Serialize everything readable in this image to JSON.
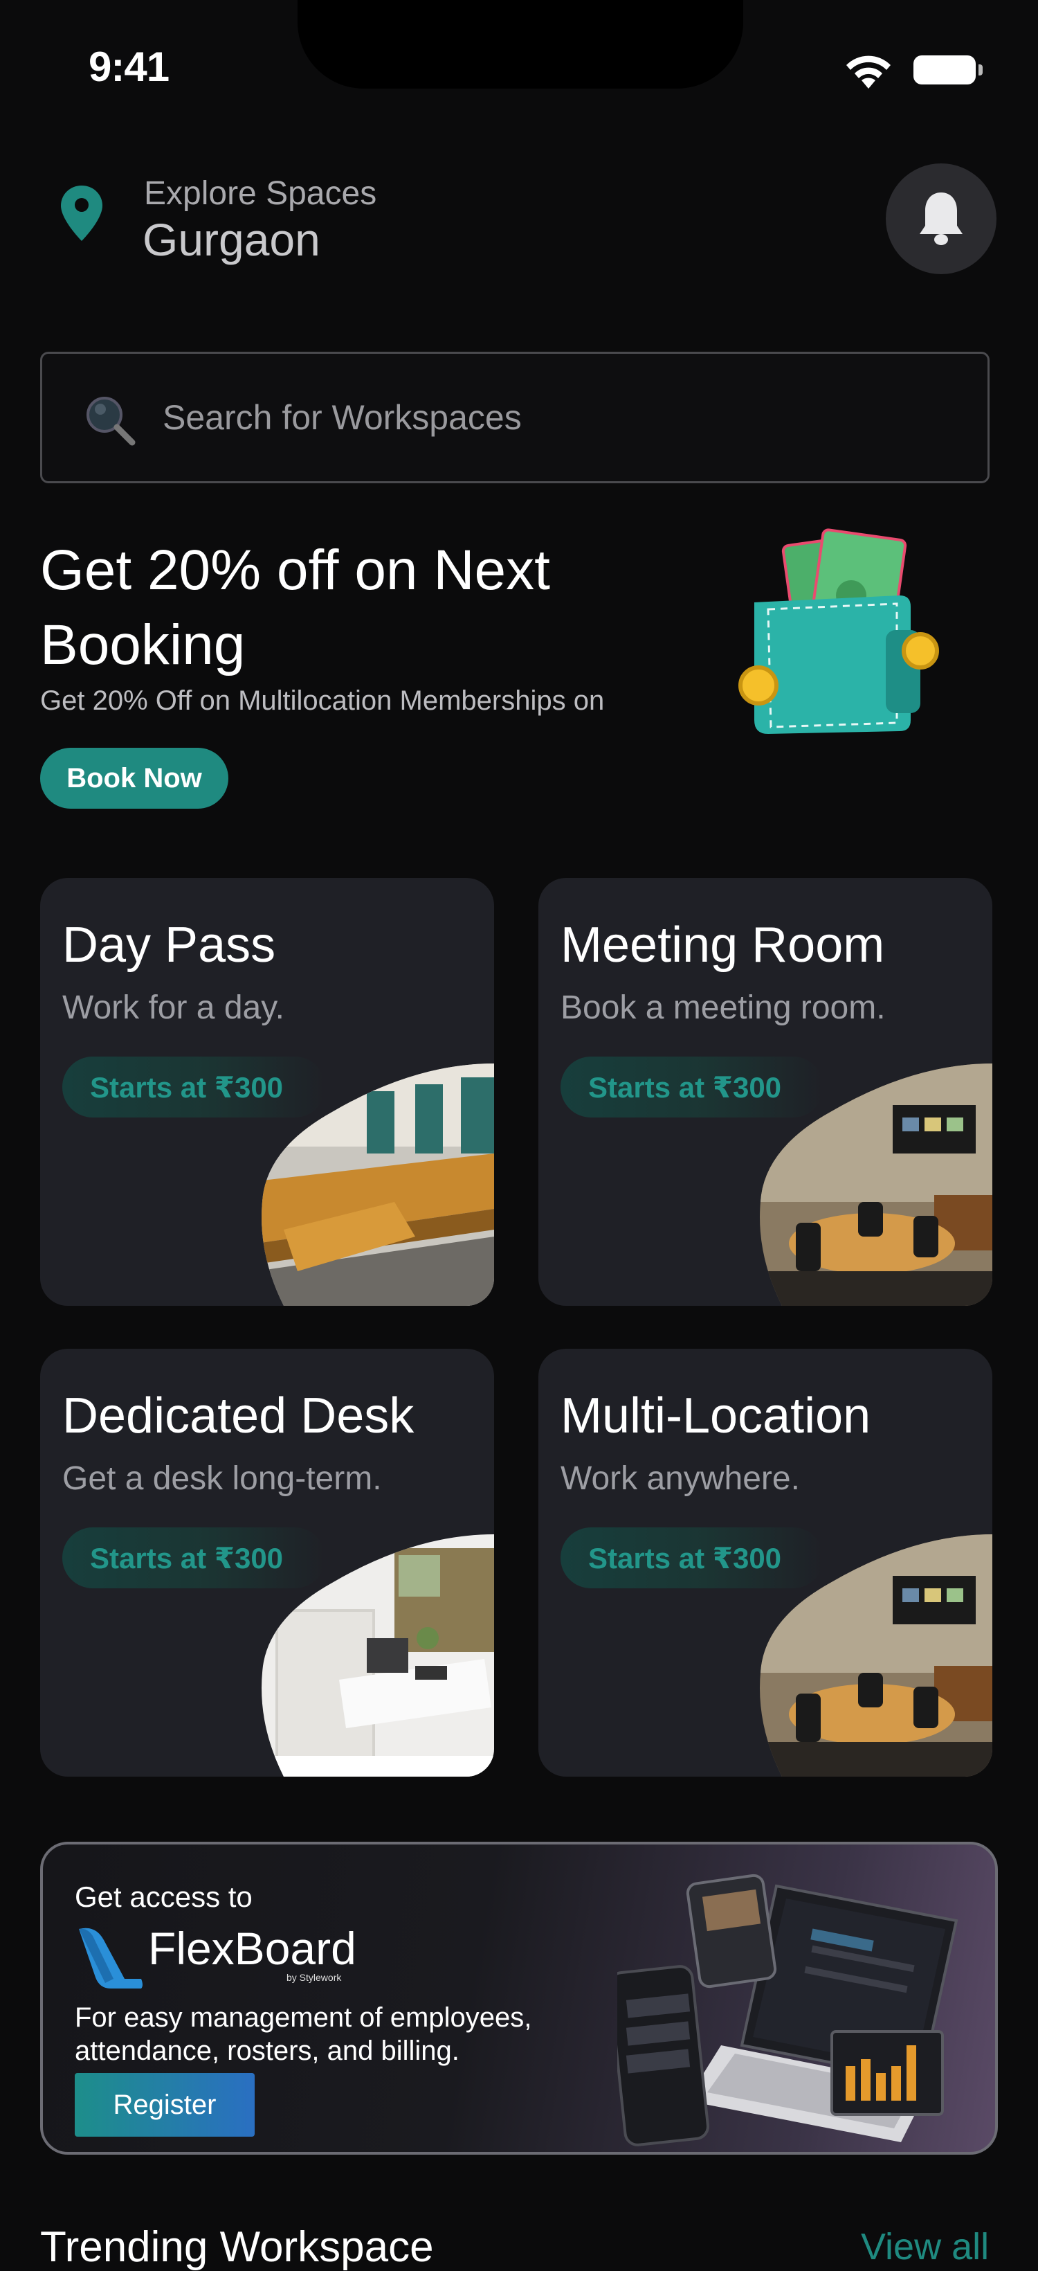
{
  "status_bar": {
    "time": "9:41"
  },
  "header": {
    "label": "Explore Spaces",
    "city": "Gurgaon"
  },
  "search": {
    "placeholder": "Search for Workspaces"
  },
  "promo": {
    "title": "Get 20% off on Next Booking",
    "subtitle": "Get 20% Off on Multilocation Memberships on",
    "button": "Book Now"
  },
  "cards": [
    {
      "title": "Day Pass",
      "subtitle": "Work for a day.",
      "price": "Starts at ₹300"
    },
    {
      "title": "Meeting Room",
      "subtitle": "Book a meeting room.",
      "price": "Starts at ₹300"
    },
    {
      "title": "Dedicated Desk",
      "subtitle": "Get a desk long-term.",
      "price": "Starts at ₹300"
    },
    {
      "title": "Multi-Location",
      "subtitle": "Work anywhere.",
      "price": "Starts at ₹300"
    }
  ],
  "flexboard": {
    "access": "Get access to",
    "brand": "FlexBoard",
    "by": "by Stylework",
    "description": "For easy management of employees, attendance, rosters, and billing.",
    "button": "Register"
  },
  "trending": {
    "title": "Trending Workspace",
    "view_all": "View all"
  },
  "colors": {
    "accent": "#1f8a80",
    "card_bg": "#1f2026",
    "background": "#0b0b0c"
  }
}
